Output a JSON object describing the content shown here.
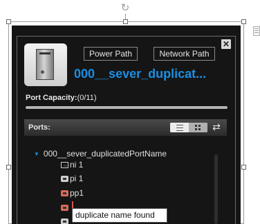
{
  "panel": {
    "close_symbol": "✕",
    "device_icon": "server-tower-icon",
    "power_path_label": "Power Path",
    "network_path_label": "Network Path",
    "device_name": "000__sever_duplicat...",
    "capacity_label": "Port Capacity:",
    "capacity_value": "(0/11)",
    "capacity_fraction": 0
  },
  "ports": {
    "header_label": "Ports:",
    "view_mode": "list",
    "refresh_symbol": "⇄",
    "tree": {
      "root_label": "000__sever_duplicatedPortName",
      "expanded": true,
      "items": [
        {
          "label": "ni 1",
          "icon": "port-box-icon"
        },
        {
          "label": "pi 1",
          "icon": "port-icon"
        },
        {
          "label": "pp1",
          "icon": "port-warning-icon"
        },
        {
          "label": "",
          "icon": "port-warning-icon"
        },
        {
          "label": "",
          "icon": "port-icon"
        }
      ]
    }
  },
  "tooltip": {
    "text": "duplicate name found"
  },
  "editor": {
    "rotate_symbol": "↻"
  },
  "colors": {
    "accent": "#1a8fe3",
    "panel_bg": "#151515",
    "warning": "#d96a5a"
  }
}
